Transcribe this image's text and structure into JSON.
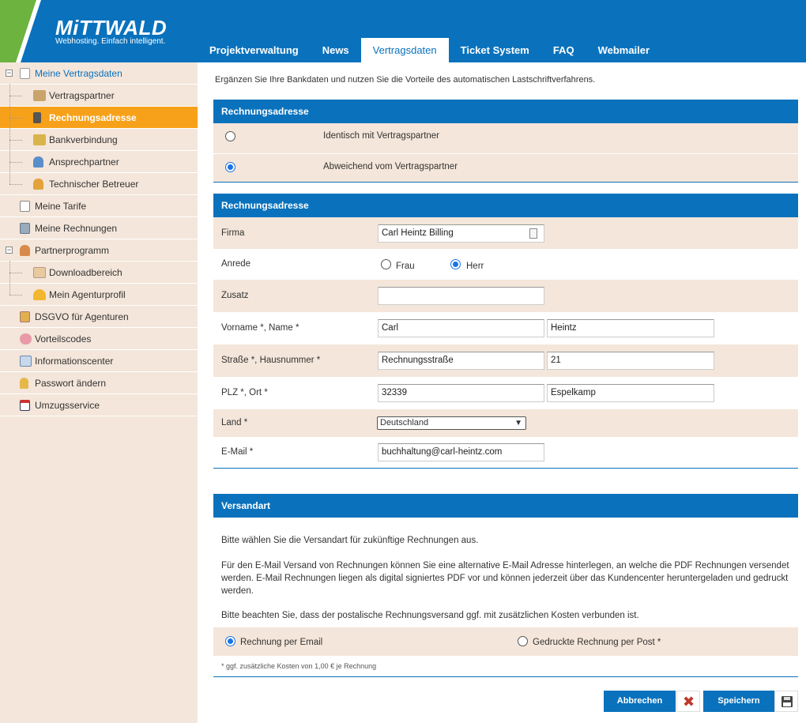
{
  "header": {
    "logo": "MiTTWALD",
    "tagline": "Webhosting. Einfach intelligent.",
    "tabs": [
      "Projektverwaltung",
      "News",
      "Vertragsdaten",
      "Ticket System",
      "FAQ",
      "Webmailer"
    ],
    "active_tab": "Vertragsdaten"
  },
  "sidebar": {
    "items": [
      {
        "label": "Meine Vertragsdaten",
        "icon": "document-icon"
      },
      {
        "label": "Vertragspartner",
        "icon": "contract-icon"
      },
      {
        "label": "Rechnungsadresse",
        "icon": "calculator-icon"
      },
      {
        "label": "Bankverbindung",
        "icon": "money-icon"
      },
      {
        "label": "Ansprechpartner",
        "icon": "person-icon"
      },
      {
        "label": "Technischer Betreuer",
        "icon": "technician-icon"
      },
      {
        "label": "Meine Tarife",
        "icon": "clipboard-icon"
      },
      {
        "label": "Meine Rechnungen",
        "icon": "invoice-icon"
      },
      {
        "label": "Partnerprogramm",
        "icon": "partner-icon"
      },
      {
        "label": "Downloadbereich",
        "icon": "download-icon"
      },
      {
        "label": "Mein Agenturprofil",
        "icon": "helmet-icon"
      },
      {
        "label": "DSGVO für Agenturen",
        "icon": "book-icon"
      },
      {
        "label": "Vorteilscodes",
        "icon": "piggy-bank-icon"
      },
      {
        "label": "Informationscenter",
        "icon": "mail-icon"
      },
      {
        "label": "Passwort ändern",
        "icon": "lock-icon"
      },
      {
        "label": "Umzugsservice",
        "icon": "calendar-icon"
      }
    ]
  },
  "intro": "Ergänzen Sie Ihre Bankdaten und nutzen Sie die Vorteile des automatischen Lastschriftverfahrens.",
  "address_type": {
    "title": "Rechnungsadresse",
    "option_same": "Identisch mit Vertragspartner",
    "option_different": "Abweichend vom Vertragspartner",
    "selected": "different"
  },
  "address_form": {
    "title": "Rechnungsadresse",
    "firma_label": "Firma",
    "firma_value": "Carl Heintz Billing",
    "anrede_label": "Anrede",
    "anrede_frau": "Frau",
    "anrede_herr": "Herr",
    "anrede_selected": "Herr",
    "zusatz_label": "Zusatz",
    "zusatz_value": "",
    "name_label": "Vorname *, Name *",
    "vorname_value": "Carl",
    "name_value": "Heintz",
    "strasse_label": "Straße *, Hausnummer *",
    "strasse_value": "Rechnungsstraße",
    "hausnummer_value": "21",
    "plz_label": "PLZ *, Ort *",
    "plz_value": "32339",
    "ort_value": "Espelkamp",
    "land_label": "Land *",
    "land_value": "Deutschland",
    "email_label": "E-Mail *",
    "email_value": "buchhaltung@carl-heintz.com"
  },
  "versandart": {
    "title": "Versandart",
    "p1": "Bitte wählen Sie die Versandart für zukünftige Rechnungen aus.",
    "p2": "Für den E-Mail Versand von Rechnungen können Sie eine alternative E-Mail Adresse hinterlegen, an welche die PDF Rechnungen versendet werden. E-Mail Rechnungen liegen als digital signiertes PDF vor und können jederzeit über das Kundencenter heruntergeladen und gedruckt werden.",
    "p3": "Bitte beachten Sie, dass der postalische Rechnungsversand ggf. mit zusätzlichen Kosten verbunden ist.",
    "option_email": "Rechnung per Email",
    "option_post": "Gedruckte Rechnung per Post *",
    "selected": "email",
    "note": "* ggf. zusätzliche Kosten von 1,00 € je Rechnung"
  },
  "buttons": {
    "cancel": "Abbrechen",
    "save": "Speichern"
  },
  "colors": {
    "brand_blue": "#0a72bd",
    "brand_green": "#6cb33f",
    "sidebar_bg": "#f4e6da",
    "active_orange": "#f7a11a"
  }
}
